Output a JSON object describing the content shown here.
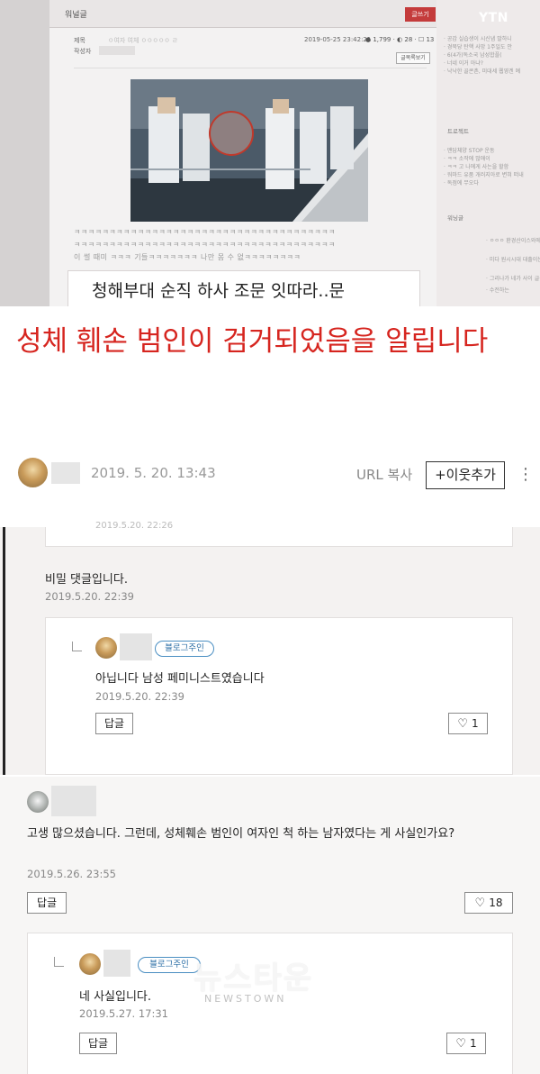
{
  "tv_capture": {
    "board_title": "워널글",
    "write_button": "글쓰기",
    "meta_title_label": "제목",
    "meta_author_label": "작성자",
    "meta_title_value": "ㅇ여자 여체 ㅇㅇㅇㅇㅇ ㄹ",
    "meta_date": "2019-05-25 23:42:21",
    "meta_stats": "● 1,799 · ◐ 28 · ☐ 13",
    "list_button": "글목록보기",
    "dots_line_1": "ㅋㅋㅋㅋㅋㅋㅋㅋㅋㅋㅋㅋㅋㅋㅋㅋㅋㅋㅋㅋㅋㅋㅋㅋㅋㅋㅋㅋㅋㅋㅋㅋㅋㅋㅋㅋㅋ",
    "dots_line_2": "ㅋㅋㅋㅋㅋㅋㅋㅋㅋㅋㅋㅋㅋㅋㅋㅋㅋㅋㅋㅋㅋㅋㅋㅋㅋㅋㅋㅋㅋㅋㅋㅋㅋㅋㅋㅋㅋ",
    "dots_line_3": "이 썰 때미 ㅋㅋㅋ 기들ㅋㅋㅋㅋㅋㅋㅋ 나만 몸 수 없ㅋㅋㅋㅋㅋㅋㅋㅋ",
    "caption": "청해부대 순직 하사 조문 잇따라..문",
    "broadcaster": "YTN",
    "sidebar": {
      "items_top": [
        "· 공감 실습생이 시신냄 말하니",
        "· 경북당 탄핵 사망 1주일도 안",
        "· 6(4가)독소국 남성합플(",
        "· 너네 이거 아냐?",
        "· 낙낙한 골콘촌, 미대세 웹영겐 예"
      ],
      "heading_mid": "트로젝트",
      "items_mid": [
        "· 맨답체양 STOP 운동",
        "· ㅋㅋ 소작에 많애이",
        "· ㅋㅋ 고 나에게 사는을 할함",
        "· 워마드 유품 개러지아로 변혀 떠내",
        "· 독점에 무오다"
      ],
      "heading_bottom": "워닝글",
      "items_bottom": [
        "· ㅇㅇㅇ 환경산이스와에",
        "· 미다 원시시대 대출이는",
        "· 그리나가 네가 사이 글실",
        "· 수전하는"
      ]
    }
  },
  "post": {
    "headline": "성체 훼손 범인이 검거되었음을 알립니다",
    "date": "2019. 5. 20. 13:43",
    "url_copy": "URL 복사",
    "add_neighbor": "+이웃추가",
    "more_menu": "⋮"
  },
  "comments": {
    "partial_top_date": "2019.5.20. 22:26",
    "secret_comment": {
      "text": "비밀 댓글입니다.",
      "date": "2019.5.20. 22:39"
    },
    "owner_reply_1": {
      "badge": "블로그주인",
      "text": "아닙니다 남성 페미니스트였습니다",
      "date": "2019.5.20. 22:39",
      "reply_label": "답글",
      "likes": "1"
    },
    "comment_2": {
      "text": "고생 많으셨습니다. 그런데, 성체훼손 범인이 여자인 척 하는 남자였다는 게 사실인가요?",
      "date": "2019.5.26. 23:55",
      "reply_label": "답글",
      "likes": "18"
    },
    "owner_reply_2": {
      "badge": "블로그주인",
      "text": "네 사실입니다.",
      "date": "2019.5.27. 17:31",
      "reply_label": "답글",
      "likes": "1"
    }
  },
  "watermark": {
    "title": "뉴스타운",
    "subtitle": "NEWSTOWN"
  },
  "colors": {
    "headline": "#d6251f",
    "badge_border": "#4a8ec2",
    "ytn_red": "#c43b3b"
  },
  "icons": {
    "heart": "heart-icon",
    "reply": "reply-arrow-icon",
    "more": "more-vertical-icon"
  }
}
